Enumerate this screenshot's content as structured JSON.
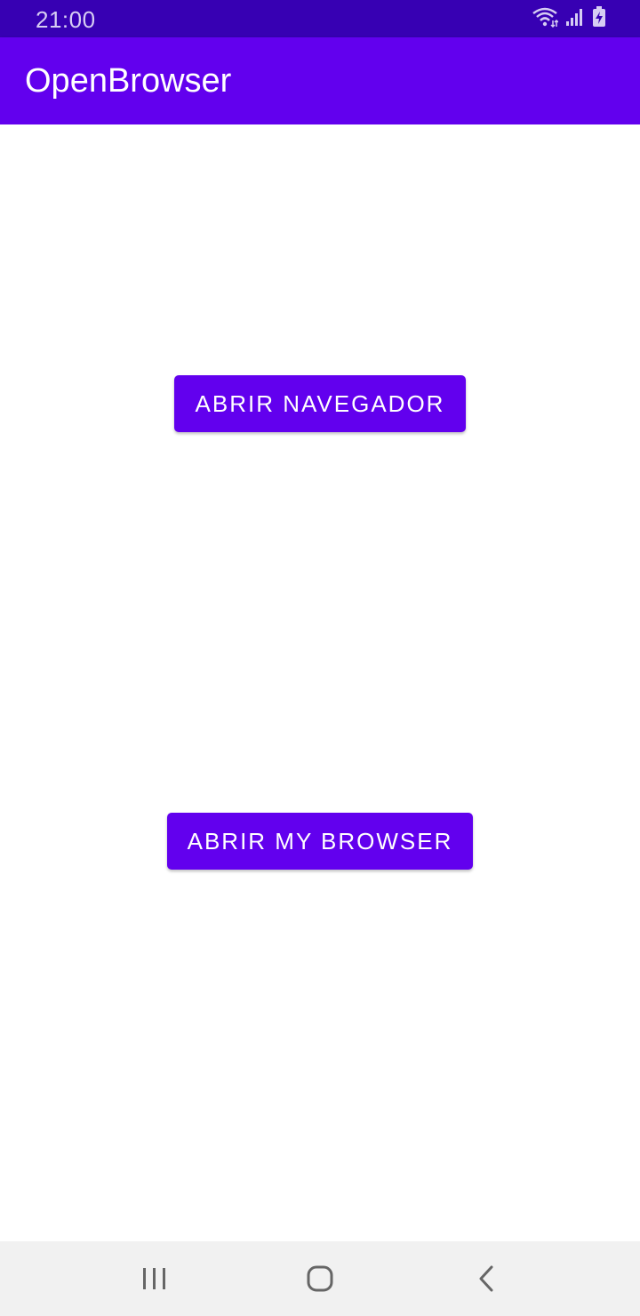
{
  "status_bar": {
    "time": "21:00",
    "icons": [
      "wifi-icon",
      "signal-icon",
      "battery-charging-icon"
    ]
  },
  "app_bar": {
    "title": "OpenBrowser",
    "color": "#6200ee"
  },
  "main": {
    "open_browser_label": "ABRIR NAVEGADOR",
    "open_my_browser_label": "ABRIR MY BROWSER",
    "button_color": "#6200ee"
  },
  "nav_bar": {
    "buttons": [
      "recents-icon",
      "home-icon",
      "back-icon"
    ]
  }
}
